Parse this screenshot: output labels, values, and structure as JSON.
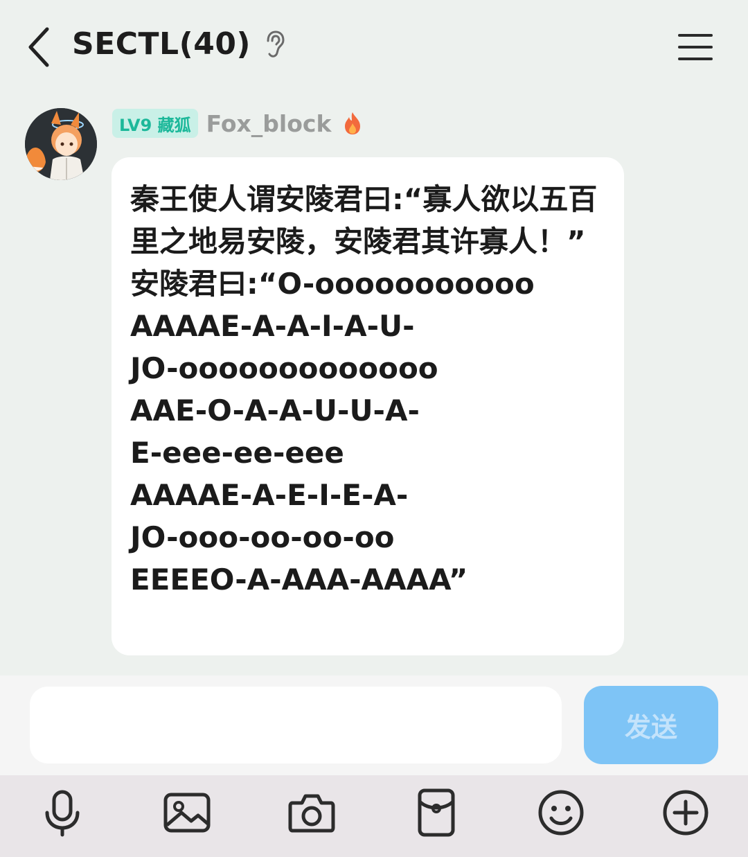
{
  "header": {
    "title": "SECTL(40)"
  },
  "message": {
    "level_badge": "LV9 藏狐",
    "username": "Fox_block",
    "text": "秦王使人谓安陵君曰:“寡人欲以五百里之地易安陵，安陵君其许寡人！”\n安陵君曰:“O-ooooooooooo\nAAAAE-A-A-I-A-U-\nJO-ooooooooooooo\nAAE-O-A-A-U-U-A-\nE-eee-ee-eee\nAAAAE-A-E-I-E-A-\nJO-ooo-oo-oo-oo\nEEEEO-A-AAA-AAAA”"
  },
  "input": {
    "value": "",
    "send_label": "发送"
  },
  "toolbar": {
    "items": [
      "microphone-icon",
      "image-icon",
      "camera-icon",
      "red-packet-icon",
      "emoji-icon",
      "plus-icon"
    ]
  },
  "colors": {
    "background": "#edf1ee",
    "badge_bg": "#c9f0e7",
    "badge_text": "#1cb89a",
    "send_button": "#7ec4f6",
    "toolbar_bg": "#e9e5e8"
  }
}
